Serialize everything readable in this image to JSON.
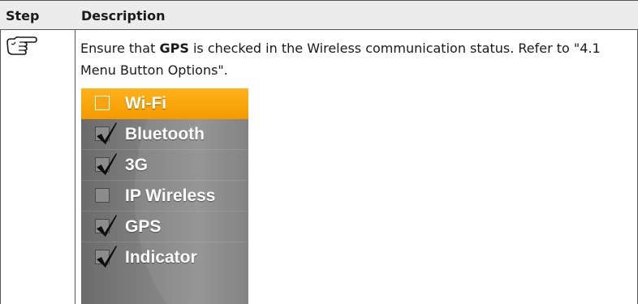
{
  "table": {
    "headers": {
      "step": "Step",
      "description": "Description"
    },
    "row": {
      "step_icon": "pointing-hand-icon",
      "desc_before": "Ensure that ",
      "desc_bold": "GPS",
      "desc_after": " is checked in the Wireless communication status. Refer to \"4.1 Menu Button Options\"."
    }
  },
  "menu": {
    "items": [
      {
        "label": "Wi-Fi",
        "checked": false,
        "selected": true
      },
      {
        "label": "Bluetooth",
        "checked": true,
        "selected": false
      },
      {
        "label": "3G",
        "checked": true,
        "selected": false
      },
      {
        "label": "IP Wireless",
        "checked": false,
        "selected": false
      },
      {
        "label": "GPS",
        "checked": true,
        "selected": false
      },
      {
        "label": "Indicator",
        "checked": true,
        "selected": false
      }
    ],
    "colors": {
      "selected": "#f39a00",
      "panel": "#7e7e7e",
      "text": "#ffffff"
    }
  }
}
